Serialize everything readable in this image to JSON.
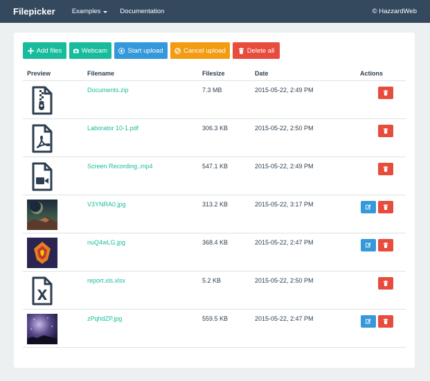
{
  "navbar": {
    "brand": "Filepicker",
    "examples": "Examples",
    "documentation": "Documentation",
    "copyright": "© HazzardWeb"
  },
  "toolbar": {
    "add_files": "Add files",
    "webcam": "Webcam",
    "start_upload": "Start upload",
    "cancel_upload": "Cancel upload",
    "delete_all": "Delete all"
  },
  "table": {
    "headers": {
      "preview": "Preview",
      "filename": "Filename",
      "filesize": "Filesize",
      "date": "Date",
      "actions": "Actions"
    },
    "rows": [
      {
        "filename": "Documents.zip",
        "filesize": "7.3 MB",
        "date": "2015-05-22, 2:49 PM",
        "icon": "zip-file-icon"
      },
      {
        "filename": "Laborator 10-1.pdf",
        "filesize": "306.3 KB",
        "date": "2015-05-22, 2:50 PM",
        "icon": "pdf-file-icon"
      },
      {
        "filename": "Screen Recording..mp4",
        "filesize": "547.1 KB",
        "date": "2015-05-22, 2:49 PM",
        "icon": "video-file-icon"
      },
      {
        "filename": "V3YNRA0.jpg",
        "filesize": "313.2 KB",
        "date": "2015-05-22, 3:17 PM",
        "icon": "image-thumbnail"
      },
      {
        "filename": "nuQ4wLG.jpg",
        "filesize": "368.4 KB",
        "date": "2015-05-22, 2:47 PM",
        "icon": "image-thumbnail"
      },
      {
        "filename": "report.xls.xlsx",
        "filesize": "5.2 KB",
        "date": "2015-05-22, 2:50 PM",
        "icon": "excel-file-icon"
      },
      {
        "filename": "zPqhdZP.jpg",
        "filesize": "559.5 KB",
        "date": "2015-05-22, 2:47 PM",
        "icon": "image-thumbnail"
      }
    ]
  },
  "colors": {
    "navbar": "#34495e",
    "success": "#18bc9c",
    "primary": "#3498db",
    "warning": "#f39c12",
    "danger": "#e74c3c"
  }
}
